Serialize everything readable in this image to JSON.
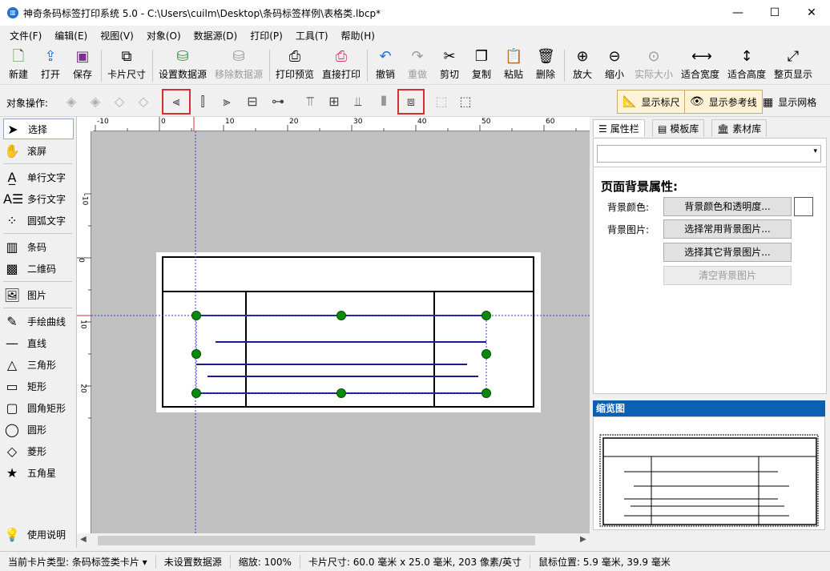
{
  "window": {
    "title": "神奇条码标签打印系统 5.0 - C:\\Users\\cuilm\\Desktop\\条码标签样例\\表格类.lbcp*",
    "minimize": "—",
    "maximize": "☐",
    "close": "✕"
  },
  "menu": [
    "文件(F)",
    "编辑(E)",
    "视图(V)",
    "对象(O)",
    "数据源(D)",
    "打印(P)",
    "工具(T)",
    "帮助(H)"
  ],
  "toolbar": {
    "new": "新建",
    "open": "打开",
    "save": "保存",
    "card_size": "卡片尺寸",
    "set_datasource": "设置数据源",
    "remove_datasource": "移除数据源",
    "print_preview": "打印预览",
    "direct_print": "直接打印",
    "undo": "撤销",
    "redo": "重做",
    "cut": "剪切",
    "copy": "复制",
    "paste": "粘贴",
    "delete": "删除",
    "zoom_in": "放大",
    "zoom_out": "缩小",
    "actual_size": "实际大小",
    "fit_width": "适合宽度",
    "fit_height": "适合高度",
    "fit_page": "整页显示"
  },
  "object_ops": {
    "label": "对象操作:",
    "show_ruler": "显示标尺",
    "show_guides": "显示参考线",
    "show_grid": "显示网格"
  },
  "tools": {
    "select": "选择",
    "scroll": "滚屏",
    "single_text": "单行文字",
    "multi_text": "多行文字",
    "arc_text": "圆弧文字",
    "barcode": "条码",
    "qrcode": "二维码",
    "image": "图片",
    "freehand": "手绘曲线",
    "line": "直线",
    "triangle": "三角形",
    "rectangle": "矩形",
    "rounded_rect": "圆角矩形",
    "ellipse": "圆形",
    "diamond": "菱形",
    "star": "五角星",
    "help": "使用说明"
  },
  "ruler": {
    "h": [
      "-10",
      "0",
      "10",
      "20",
      "30",
      "40",
      "50",
      "60"
    ],
    "v": [
      "-10",
      "0",
      "10",
      "20"
    ]
  },
  "right_tabs": {
    "props": "属性栏",
    "templates": "模板库",
    "assets": "素材库"
  },
  "props": {
    "heading": "页面背景属性:",
    "bg_color_label": "背景颜色:",
    "bg_color_btn": "背景颜色和透明度...",
    "bg_image_label": "背景图片:",
    "bg_common_btn": "选择常用背景图片...",
    "bg_other_btn": "选择其它背景图片...",
    "bg_clear_btn": "清空背景图片"
  },
  "thumbnail": {
    "title": "缩览图"
  },
  "status": {
    "card_type": "当前卡片类型: 条码标签类卡片 ▾",
    "datasource": "未设置数据源",
    "zoom": "缩放: 100%",
    "card_size": "卡片尺寸: 60.0 毫米 x 25.0 毫米, 203 像素/英寸",
    "mouse": "鼠标位置: 5.9 毫米, 39.9 毫米"
  }
}
